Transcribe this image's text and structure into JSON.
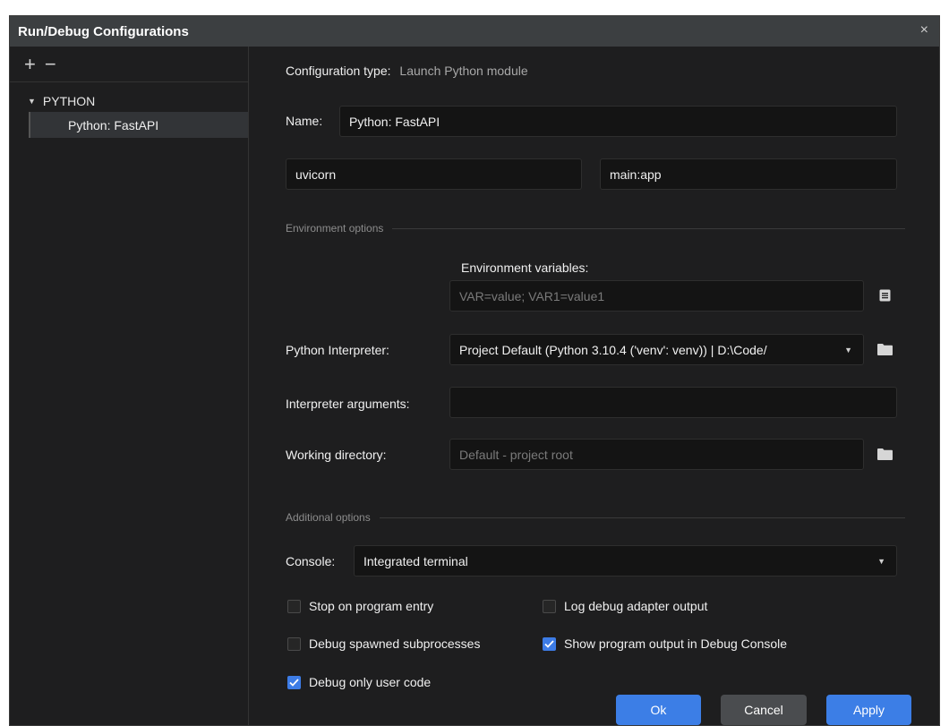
{
  "dialog": {
    "title": "Run/Debug Configurations",
    "close_glyph": "×"
  },
  "sidebar": {
    "add_glyph": "+",
    "remove_glyph": "−",
    "group_label": "PYTHON",
    "items": [
      {
        "label": "Python: FastAPI",
        "selected": true
      }
    ]
  },
  "config": {
    "type_label": "Configuration type:",
    "type_value": "Launch Python module",
    "name_label": "Name:",
    "name_value": "Python: FastAPI",
    "module_value": "uvicorn",
    "args_value": "main:app"
  },
  "environment": {
    "section_title": "Environment options",
    "env_vars_label": "Environment variables:",
    "env_vars_placeholder": "VAR=value; VAR1=value1",
    "interpreter_label": "Python Interpreter:",
    "interpreter_value": "Project Default (Python 3.10.4 ('venv': venv)) | D:\\Code/",
    "interp_args_label": "Interpreter arguments:",
    "interp_args_value": "",
    "workdir_label": "Working directory:",
    "workdir_placeholder": "Default - project root"
  },
  "additional": {
    "section_title": "Additional options",
    "console_label": "Console:",
    "console_value": "Integrated terminal",
    "checkboxes": [
      {
        "label": "Stop on program entry",
        "checked": false
      },
      {
        "label": "Log debug adapter output",
        "checked": false
      },
      {
        "label": "Debug spawned subprocesses",
        "checked": false
      },
      {
        "label": "Show program output in Debug Console",
        "checked": true
      },
      {
        "label": "Debug only user code",
        "checked": true
      }
    ]
  },
  "buttons": {
    "ok": "Ok",
    "cancel": "Cancel",
    "apply": "Apply"
  },
  "colors": {
    "accent": "#3c7ee6",
    "background": "#1e1e1f",
    "titlebar": "#3c3f41"
  }
}
